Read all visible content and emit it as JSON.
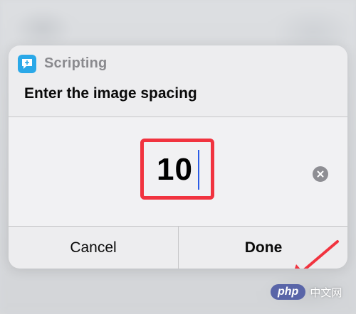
{
  "dialog": {
    "app_name": "Scripting",
    "app_icon": "scripting-app-icon",
    "prompt": "Enter the image spacing",
    "input": {
      "value": "10"
    },
    "buttons": {
      "cancel": "Cancel",
      "done": "Done"
    }
  },
  "annotation": {
    "highlight_color": "#f1333f",
    "arrow_color": "#f1333f"
  },
  "watermark": {
    "badge": "php",
    "text": "中文网"
  }
}
